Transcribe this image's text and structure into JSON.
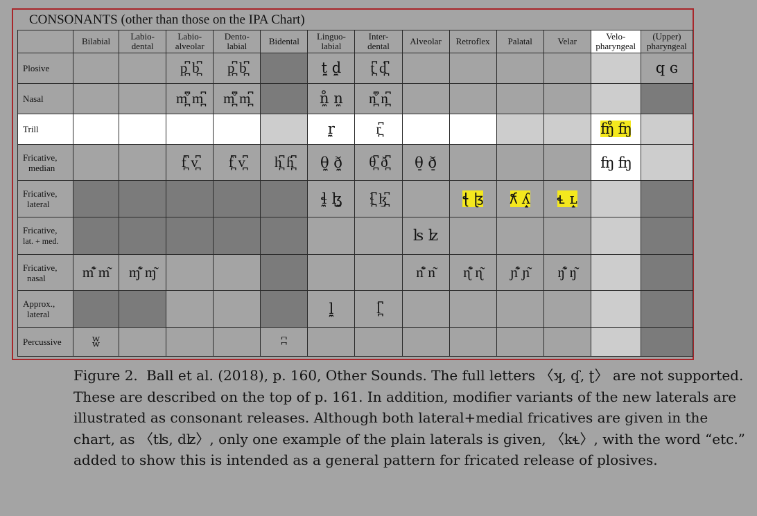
{
  "chart": {
    "title": "CONSONANTS (other than those on the IPA Chart)",
    "columns": [
      "Bilabial",
      "Labio-\ndental",
      "Labio-\nalveolar",
      "Dento-\nlabial",
      "Bidental",
      "Linguo-\nlabial",
      "Inter-\ndental",
      "Alveolar",
      "Retroflex",
      "Palatal",
      "Velar",
      "Velo-\npharyngeal",
      "(Upper)\npharyngeal"
    ],
    "rows": [
      {
        "label": "Plosive",
        "cells": [
          "",
          "",
          "p̪͆ b̪͆",
          "p̪͆ b̪͆",
          "",
          "t̼ d̼",
          "t̪͆ d̪͆",
          "",
          "",
          "",
          "",
          "",
          "q ɢ"
        ]
      },
      {
        "label": "Nasal",
        "cells": [
          "",
          "",
          "m̪͆̊ m̪͆",
          "m̪͆̊ m̪͆",
          "",
          "n̼̊ n̼",
          "n̪͆̊ n̪͆",
          "",
          "",
          "",
          "",
          "",
          ""
        ]
      },
      {
        "label": "Trill",
        "cells": [
          "",
          "",
          "",
          "",
          "",
          "r̼",
          "r̪͆",
          "",
          "",
          "",
          "",
          "ʩ̊ ʩ",
          ""
        ]
      },
      {
        "label": "Fricative,\nmedian",
        "cells": [
          "",
          "",
          "f̪͆ v̪͆",
          "f̪͆ v̪͆",
          "h̪͆ ɦ̪͆",
          "θ̼ ð̼",
          "θ̪͆ ð̪͆",
          "θ̠ ð̠",
          "",
          "",
          "",
          "ʩ ʩ",
          ""
        ]
      },
      {
        "label": "Fricative,\nlateral",
        "cells": [
          "",
          "",
          "",
          "",
          "",
          "ɬ̼ ɮ̼",
          "ɬ̪͆ ɮ̪͆",
          "",
          "ꞎ 𝼅",
          "𝼆 ʎ̝",
          "𝼄 ʟ̝",
          "",
          ""
        ]
      },
      {
        "label": "Fricative,\nlat. + med.",
        "cells": [
          "",
          "",
          "",
          "",
          "",
          "",
          "",
          "ʪ ʫ",
          "",
          "",
          "",
          "",
          ""
        ]
      },
      {
        "label": "Fricative,\nnasal",
        "cells": [
          "m̊͂ m͂",
          "ɱ̊͂ ɱ͂",
          "",
          "",
          "",
          "",
          "",
          "n̊͂ n͂",
          "ɳ̊͂ ɳ͂",
          "ɲ̊͂ ɲ͂",
          "ŋ̊͂ ŋ͂",
          "",
          ""
        ]
      },
      {
        "label": "Approx.,\nlateral",
        "cells": [
          "",
          "",
          "",
          "",
          "",
          "l̼",
          "l̪͆",
          "",
          "",
          "",
          "",
          "",
          ""
        ]
      },
      {
        "label": "Percussive",
        "cells": [
          "ʬ",
          "",
          "",
          "",
          "ʭ",
          "",
          "",
          "",
          "",
          "",
          "",
          "",
          ""
        ]
      }
    ]
  },
  "caption": {
    "figure_label": "Figure 2.",
    "text": "Ball et al. (2018), p. 160, Other Sounds. The full letters 〈ʞ, ʠ, ʈ〉 are not supported. These are described on the top of p. 161. In addition, modifier variants of the new laterals are illustrated as consonant releases. Although both lateral+medial fricatives are given in the chart, as 〈tʪ, dʫ〉, only one example of the plain laterals is given, 〈k𝼄〉, with the word “etc.” added to show this is intended as a general pattern for fricated release of plosives."
  },
  "colors": {
    "frame_border": "#a8262a",
    "highlight": "#f4e81e",
    "shaded_cell": "#7b7b7b",
    "page_bg": "#a4a4a4"
  }
}
